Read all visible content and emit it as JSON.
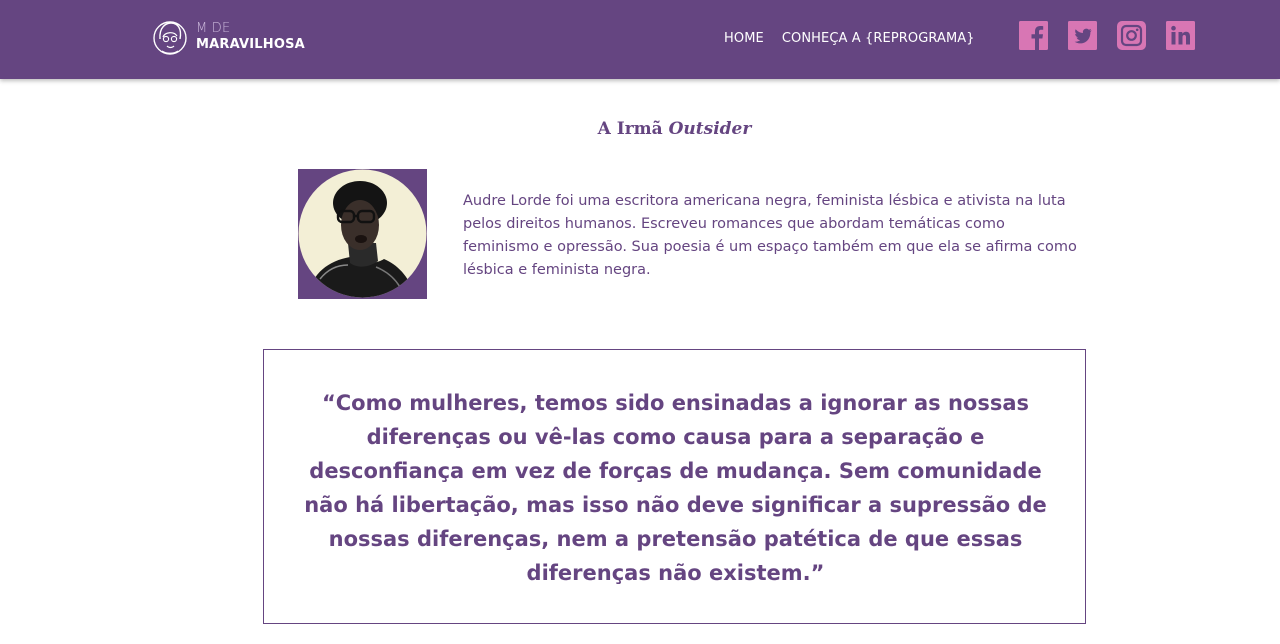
{
  "navbar": {
    "logo": {
      "line1": "M DE",
      "line2": "MARAVILHOSA"
    },
    "links": [
      {
        "label": "HOME"
      },
      {
        "label": "CONHEÇA A {REPROGRAMA}"
      }
    ],
    "social": [
      "facebook-icon",
      "twitter-icon",
      "instagram-icon",
      "linkedin-icon"
    ],
    "social_color": "#d876b4"
  },
  "profile": {
    "title_prefix": "A Irmã",
    "title_emphasis": "Outsider",
    "bio": "Audre Lorde foi uma escritora americana negra, feminista lésbica e ativista na luta pelos direitos humanos. Escreveu romances que abordam temáticas como feminismo e opressão. Sua poesia é um espaço também em que ela se afirma como lésbica e feminista negra."
  },
  "quote": {
    "text": "“Como mulheres, temos sido ensinadas a ignorar as nossas diferenças ou vê-las como causa para a separação e desconfiança em vez de forças de mudança. Sem comunidade não há libertação, mas isso não deve significar a supressão de nossas diferenças, nem a pretensão patética de que essas diferenças não existem.”"
  },
  "colors": {
    "brand_purple": "#654581",
    "accent_pink": "#d876b4",
    "portrait_bg": "#f3efd6"
  }
}
